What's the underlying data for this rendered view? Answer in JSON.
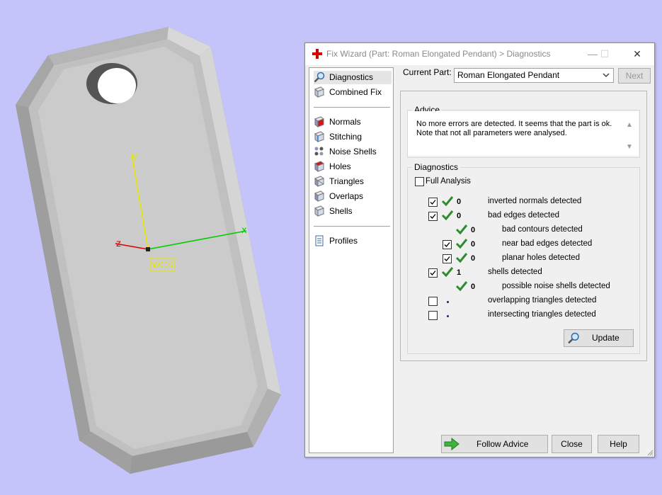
{
  "viewport": {
    "background": "#c4c4fb",
    "axes": {
      "y_label": "y",
      "x_label": "x",
      "z_label": "z",
      "wcs_label": "WCS"
    }
  },
  "dialog": {
    "title": "Fix Wizard (Part: Roman Elongated Pendant) > Diagnostics",
    "window_controls": {
      "minimize": "—",
      "maximize": "☐",
      "close": "✕"
    },
    "nav": [
      {
        "label": "Diagnostics",
        "icon": "magnifier-icon",
        "selected": true
      },
      {
        "label": "Combined Fix",
        "icon": "cube-icon"
      },
      {
        "label": "Normals",
        "icon": "normals-cube-icon"
      },
      {
        "label": "Stitching",
        "icon": "stitching-icon"
      },
      {
        "label": "Noise Shells",
        "icon": "noise-shells-icon"
      },
      {
        "label": "Holes",
        "icon": "holes-icon"
      },
      {
        "label": "Triangles",
        "icon": "triangles-icon"
      },
      {
        "label": "Overlaps",
        "icon": "overlaps-icon"
      },
      {
        "label": "Shells",
        "icon": "shells-icon"
      },
      {
        "label": "Profiles",
        "icon": "document-icon"
      }
    ],
    "current_part": {
      "label": "Current Part:",
      "value": "Roman Elongated Pendant"
    },
    "next_button": "Next",
    "advice": {
      "title": "Advice",
      "text": "No more errors are detected. It seems that the part is ok.\nNote that not all parameters were analysed."
    },
    "diagnostics": {
      "title": "Diagnostics",
      "full_analysis": {
        "label": "Full Analysis",
        "checked": false
      },
      "rows": [
        {
          "checkbox": true,
          "checked": true,
          "status": "ok",
          "value": "0",
          "label": "inverted normals detected",
          "indent": 0
        },
        {
          "checkbox": true,
          "checked": true,
          "status": "ok",
          "value": "0",
          "label": "bad edges detected",
          "indent": 0
        },
        {
          "checkbox": false,
          "checked": false,
          "status": "ok",
          "value": "0",
          "label": "bad contours detected",
          "indent": 1
        },
        {
          "checkbox": true,
          "checked": true,
          "status": "ok",
          "value": "0",
          "label": "near bad edges detected",
          "indent": 1
        },
        {
          "checkbox": true,
          "checked": true,
          "status": "ok",
          "value": "0",
          "label": "planar holes detected",
          "indent": 1
        },
        {
          "checkbox": true,
          "checked": true,
          "status": "ok",
          "value": "1",
          "label": "shells detected",
          "indent": 0
        },
        {
          "checkbox": false,
          "checked": false,
          "status": "ok",
          "value": "0",
          "label": "possible noise shells detected",
          "indent": 1
        },
        {
          "checkbox": true,
          "checked": false,
          "status": "pending",
          "value": "",
          "label": "overlapping triangles detected",
          "indent": 0
        },
        {
          "checkbox": true,
          "checked": false,
          "status": "pending",
          "value": "",
          "label": "intersecting triangles detected",
          "indent": 0
        }
      ],
      "update_button": "Update"
    },
    "footer": {
      "follow_advice": "Follow Advice",
      "close": "Close",
      "help": "Help"
    },
    "colors": {
      "check_green": "#2e8b2e",
      "accent_red": "#d40000"
    }
  }
}
